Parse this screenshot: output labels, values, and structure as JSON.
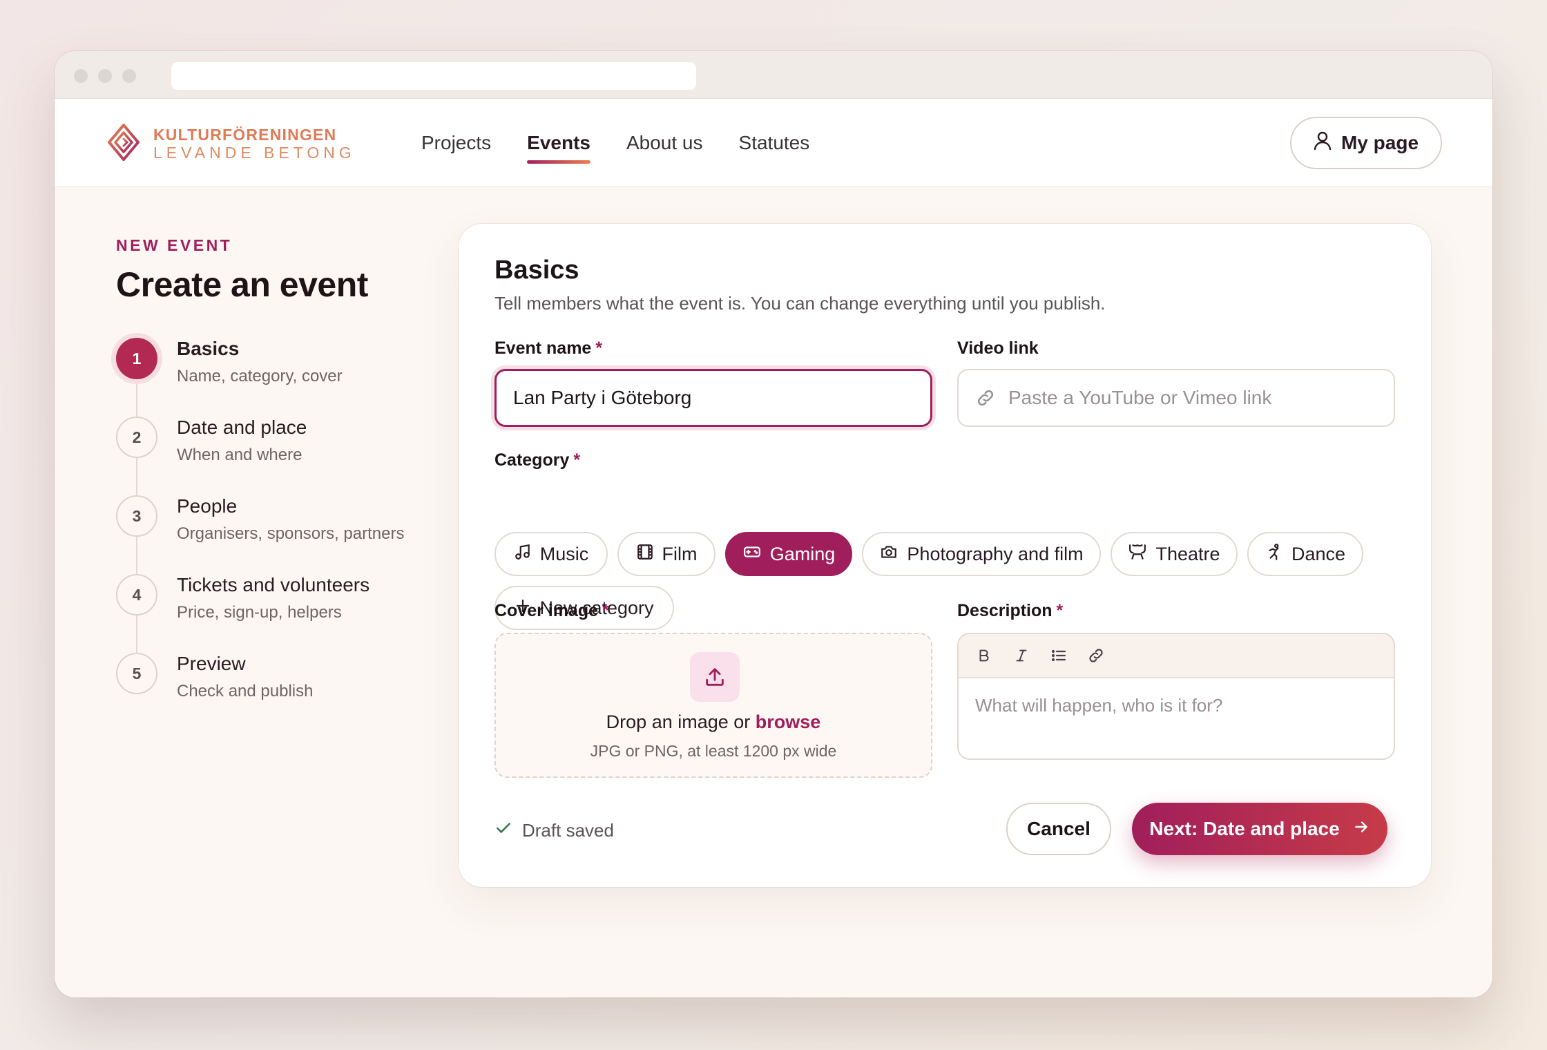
{
  "brand": {
    "line1": "KULTURFÖRENINGEN",
    "line2": "LEVANDE BETONG"
  },
  "nav": {
    "links": [
      {
        "label": "Projects",
        "active": false
      },
      {
        "label": "Events",
        "active": true
      },
      {
        "label": "About us",
        "active": false
      },
      {
        "label": "Statutes",
        "active": false
      }
    ],
    "my_page": "My page"
  },
  "sidebar": {
    "eyebrow": "NEW EVENT",
    "title": "Create an event",
    "steps": [
      {
        "num": "1",
        "title": "Basics",
        "sub": "Name, category, cover",
        "active": true
      },
      {
        "num": "2",
        "title": "Date and place",
        "sub": "When and where",
        "active": false
      },
      {
        "num": "3",
        "title": "People",
        "sub": "Organisers, sponsors, partners",
        "active": false
      },
      {
        "num": "4",
        "title": "Tickets and volunteers",
        "sub": "Price, sign-up, helpers",
        "active": false
      },
      {
        "num": "5",
        "title": "Preview",
        "sub": "Check and publish",
        "active": false
      }
    ]
  },
  "form": {
    "title": "Basics",
    "subtitle": "Tell members what the event is. You can change everything until you publish.",
    "required_mark": "*",
    "event_name": {
      "label": "Event name",
      "value": "Lan Party i Göteborg"
    },
    "video_link": {
      "label": "Video link",
      "placeholder": "Paste a YouTube or Vimeo link"
    },
    "category": {
      "label": "Category",
      "options": [
        {
          "label": "Music",
          "icon": "music-note-icon",
          "selected": false
        },
        {
          "label": "Film",
          "icon": "film-icon",
          "selected": false
        },
        {
          "label": "Gaming",
          "icon": "gamepad-icon",
          "selected": true
        },
        {
          "label": "Photography and film",
          "icon": "camera-icon",
          "selected": false
        },
        {
          "label": "Theatre",
          "icon": "theatre-icon",
          "selected": false
        },
        {
          "label": "Dance",
          "icon": "dance-icon",
          "selected": false
        }
      ],
      "new_label": "New category"
    },
    "cover": {
      "label": "Cover image",
      "drop_text": "Drop an image or",
      "browse": "browse",
      "hint": "JPG or PNG, at least 1200 px wide"
    },
    "description": {
      "label": "Description",
      "placeholder": "What will happen, who is it for?"
    },
    "draft_status": "Draft saved",
    "cancel": "Cancel",
    "next": "Next: Date and place"
  },
  "colors": {
    "accent": "#a01e5b",
    "accent_end": "#c73b48",
    "brand_orange": "#e07a55"
  }
}
